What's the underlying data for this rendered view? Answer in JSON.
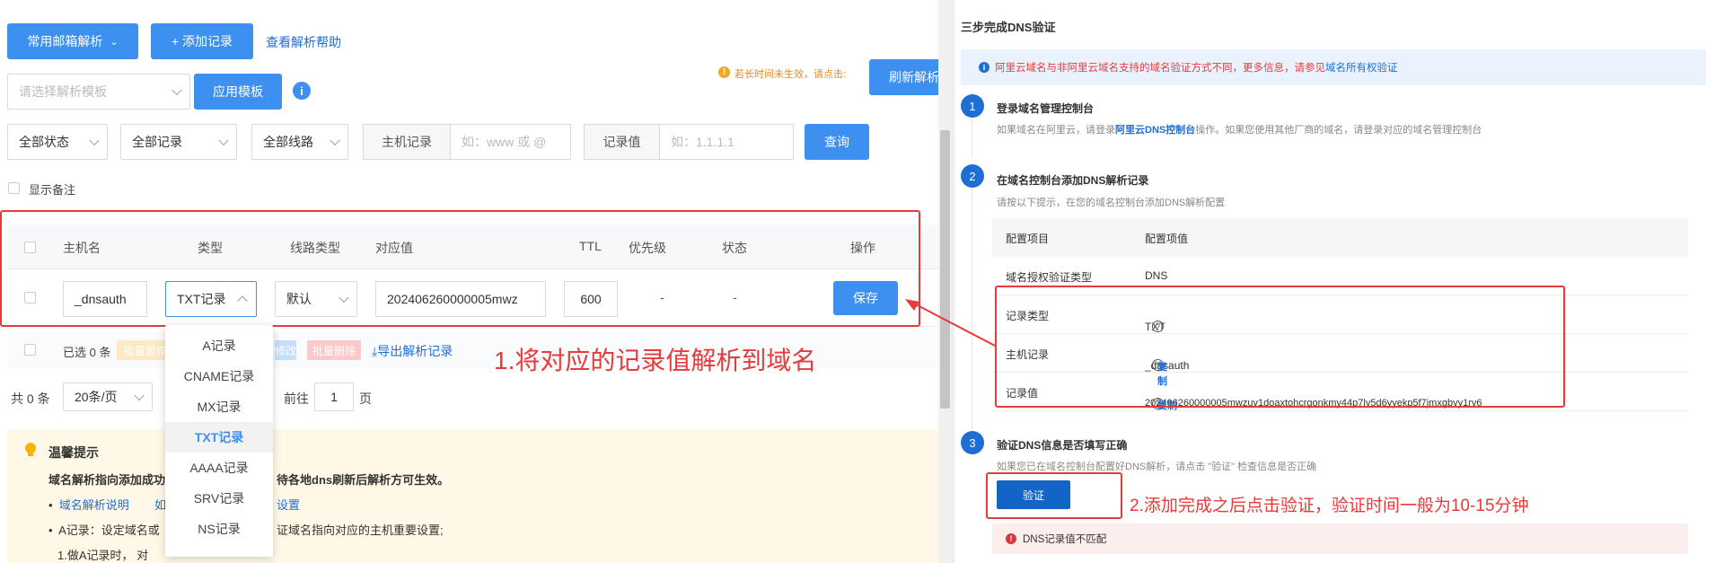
{
  "toolbar": {
    "common_mail": "常用邮箱解析",
    "add_record": "+ 添加记录",
    "help_link": "查看解析帮助"
  },
  "template": {
    "placeholder": "请选择解析模板",
    "apply": "应用模板",
    "notice": "若长时间未生效，请点击:",
    "refresh": "刷新解析"
  },
  "filters": {
    "status": "全部状态",
    "records": "全部记录",
    "lines": "全部线路",
    "host_label": "主机记录",
    "host_placeholder": "如：www 或 @",
    "value_label": "记录值",
    "value_placeholder": "如：1.1.1.1",
    "query": "查询",
    "show_remark": "显示备注"
  },
  "table": {
    "headers": [
      "主机名",
      "类型",
      "线路类型",
      "对应值",
      "TTL",
      "优先级",
      "状态",
      "操作"
    ],
    "row": {
      "host": "_dnsauth",
      "type": "TXT记录",
      "line": "默认",
      "value": "202406260000005mwz",
      "ttl": "600",
      "priority": "-",
      "status": "-",
      "save": "保存"
    },
    "selected": "已选 0 条",
    "batch_pause": "批量暂停",
    "batch_modify": "修改",
    "batch_delete": "批量删除",
    "export": "导出解析记录"
  },
  "pager": {
    "total": "共 0 条",
    "per_page": "20条/页",
    "goto": "前往",
    "page": "1",
    "page_unit": "页"
  },
  "type_dropdown": [
    "A记录",
    "CNAME记录",
    "MX记录",
    "TXT记录",
    "AAAA记录",
    "SRV记录",
    "NS记录"
  ],
  "tips": {
    "title": "温馨提示",
    "line1a": "域名解析指向添加成功",
    "line1b": "待各地dns刷新后解析方可生效。",
    "link1": "域名解析说明",
    "link2": "如",
    "link3": "设置",
    "line2a": "A记录：设定域名或",
    "line2b": "证域名指向对应的主机重要设置;",
    "line3": "1.做A记录时，  对"
  },
  "annotations": {
    "one": "1.将对应的记录值解析到域名",
    "two": "2.添加完成之后点击验证，验证时间一般为10-15分钟"
  },
  "verify": {
    "title": "三步完成DNS验证",
    "notice_a": "阿里云域名与非阿里云域名支持的域名验证方式不同，更多信息，请参见",
    "notice_link": "域名所有权验证",
    "step1_num": "1",
    "step1_title": "登录域名管理控制台",
    "step1_desc_a": "如果域名在阿里云，请登录",
    "step1_link": "阿里云DNS控制台",
    "step1_desc_b": "操作。如果您使用其他厂商的域名，请登录对应的域名管理控制台",
    "step2_num": "2",
    "step2_title": "在域名控制台添加DNS解析记录",
    "step2_desc": "请按以下提示，在您的域名控制台添加DNS解析配置",
    "cfg_head_item": "配置项目",
    "cfg_head_value": "配置项值",
    "cfg": [
      {
        "item": "域名授权验证类型",
        "value": "DNS"
      },
      {
        "item": "记录类型",
        "value": "TXT"
      },
      {
        "item": "主机记录",
        "value": "_dnsauth",
        "copy": "复制"
      },
      {
        "item": "记录值",
        "value": "202406260000005mwzuv1doaxtohcrgonkmy44p7lv5d6yyekp5f7jmxgbvy1rv6",
        "copy": "复制"
      }
    ],
    "step3_num": "3",
    "step3_title": "验证DNS信息是否填写正确",
    "step3_desc": "如果您已在域名控制台配置好DNS解析，请点击 \"验证\" 检查信息是否正确",
    "verify_btn": "验证",
    "error": "DNS记录值不匹配"
  },
  "colors": {
    "primary": "#3d8ff0",
    "dark_primary": "#1f6ed4",
    "annotation_red": "#e73a3a"
  }
}
